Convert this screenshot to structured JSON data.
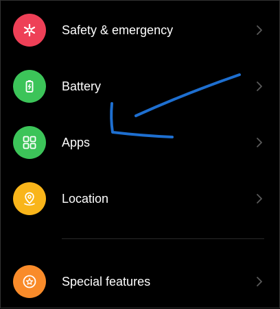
{
  "settings": {
    "items": [
      {
        "label": "Safety & emergency",
        "icon": "asterisk-icon",
        "color": "#EE4057"
      },
      {
        "label": "Battery",
        "icon": "battery-icon",
        "color": "#3CC459"
      },
      {
        "label": "Apps",
        "icon": "apps-grid-icon",
        "color": "#3CC459"
      },
      {
        "label": "Location",
        "icon": "location-pin-icon",
        "color": "#F9B51A"
      },
      {
        "label": "Special features",
        "icon": "star-icon",
        "color": "#F98B2A"
      }
    ]
  },
  "annotation": {
    "color": "#1E6FD0",
    "shape": "hand-drawn arrow pointing to Apps"
  }
}
